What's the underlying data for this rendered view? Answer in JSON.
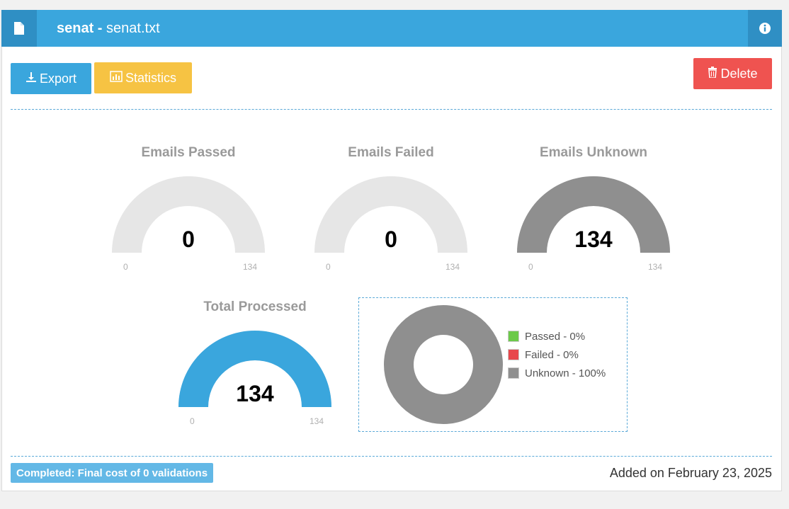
{
  "header": {
    "title_bold": "senat -",
    "title_rest": "senat.txt"
  },
  "toolbar": {
    "export_label": "Export",
    "statistics_label": "Statistics",
    "delete_label": "Delete"
  },
  "gauges": [
    {
      "label": "Emails Passed",
      "value": "0",
      "min": "0",
      "max": "134",
      "fill_fraction": 0,
      "color": "#e6e6e6"
    },
    {
      "label": "Emails Failed",
      "value": "0",
      "min": "0",
      "max": "134",
      "fill_fraction": 0,
      "color": "#e6e6e6"
    },
    {
      "label": "Emails Unknown",
      "value": "134",
      "min": "0",
      "max": "134",
      "fill_fraction": 1,
      "color": "#8f8f8f"
    },
    {
      "label": "Total Processed",
      "value": "134",
      "min": "0",
      "max": "134",
      "fill_fraction": 1,
      "color": "#3aa6dd"
    }
  ],
  "donut": {
    "legend": [
      {
        "label": "Passed - 0%",
        "color": "#6cc94a"
      },
      {
        "label": "Failed - 0%",
        "color": "#e8474c"
      },
      {
        "label": "Unknown - 100%",
        "color": "#8f8f8f"
      }
    ]
  },
  "footer": {
    "status_badge": "Completed: Final cost of 0 validations",
    "added_on": "Added on February 23, 2025"
  },
  "colors": {
    "header": "#3aa6dd",
    "header_dark": "#2f8fc4",
    "export": "#3aa6dd",
    "statistics": "#f6c343",
    "delete": "#ef5350",
    "gauge_track": "#e6e6e6"
  },
  "icons": {
    "file": "file-icon",
    "info": "info-icon",
    "download": "download-icon",
    "bar_chart": "bar-chart-icon",
    "trash": "trash-icon"
  }
}
